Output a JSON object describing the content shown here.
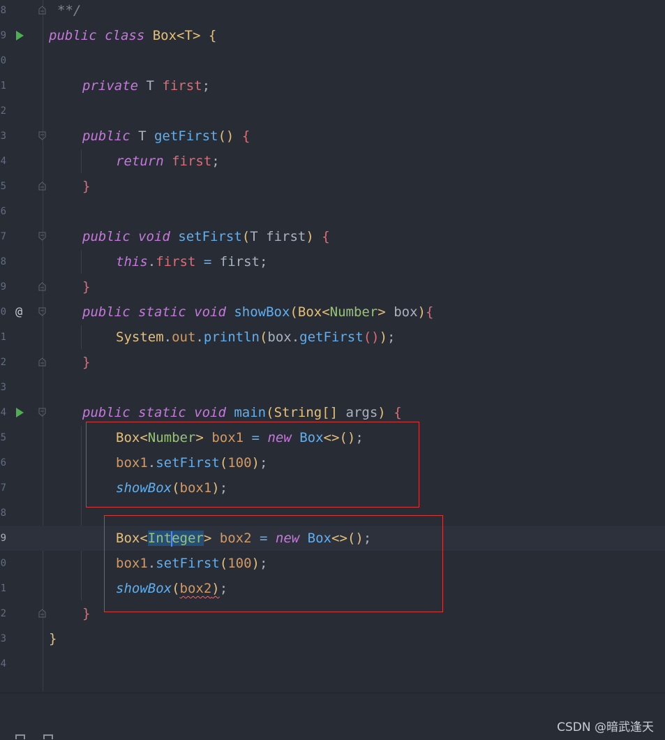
{
  "editor": {
    "file_language": "Java",
    "current_line_number": "9",
    "lines": [
      {
        "num": "8",
        "text": "**/"
      },
      {
        "num": "9",
        "text": "public class Box<T> {"
      },
      {
        "num": "0",
        "text": ""
      },
      {
        "num": "1",
        "text": "private T first;"
      },
      {
        "num": "2",
        "text": ""
      },
      {
        "num": "3",
        "text": "public T getFirst() {"
      },
      {
        "num": "4",
        "text": "return first;"
      },
      {
        "num": "5",
        "text": "}"
      },
      {
        "num": "6",
        "text": ""
      },
      {
        "num": "7",
        "text": "public void setFirst(T first) {"
      },
      {
        "num": "8",
        "text": "this.first = first;"
      },
      {
        "num": "9",
        "text": "}"
      },
      {
        "num": "0",
        "text": "public static void showBox(Box<Number> box){"
      },
      {
        "num": "1",
        "text": "System.out.println(box.getFirst());"
      },
      {
        "num": "2",
        "text": "}"
      },
      {
        "num": "3",
        "text": ""
      },
      {
        "num": "4",
        "text": "public static void main(String[] args) {"
      },
      {
        "num": "5",
        "text": "Box<Number> box1 = new Box<>();"
      },
      {
        "num": "6",
        "text": "box1.setFirst(100);"
      },
      {
        "num": "7",
        "text": "showBox(box1);"
      },
      {
        "num": "8",
        "text": ""
      },
      {
        "num": "9",
        "text": "Box<Integer> box2 = new Box<>();"
      },
      {
        "num": "0",
        "text": "box1.setFirst(100);"
      },
      {
        "num": "1",
        "text": "showBox(box2);"
      },
      {
        "num": "2",
        "text": "}"
      },
      {
        "num": "3",
        "text": "}"
      },
      {
        "num": "4",
        "text": ""
      }
    ]
  },
  "watermark": "CSDN @暗武逢天",
  "colors": {
    "background": "#282c34",
    "keyword": "#c678dd",
    "class": "#e5c07b",
    "method": "#61afef",
    "field": "#e06c75",
    "number": "#d19a66",
    "highlight_box": "#d83a3a"
  }
}
